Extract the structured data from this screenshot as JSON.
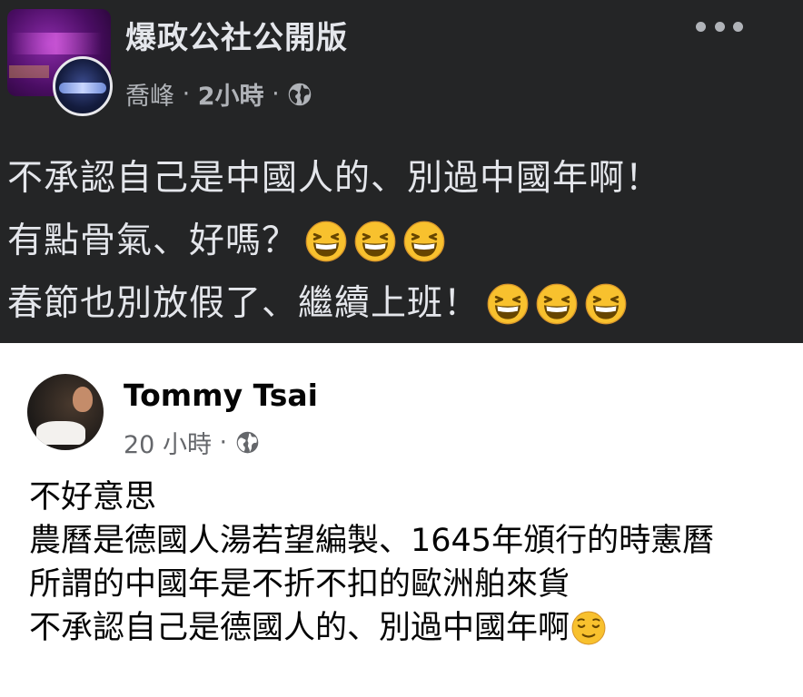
{
  "original_post": {
    "page_name": "爆政公社公開版",
    "author": "喬峰",
    "time": "2小時",
    "privacy_icon": "globe-icon",
    "menu_icon": "more-horizontal-icon",
    "lines": [
      {
        "text": "不承認自己是中國人的、別過中國年啊！",
        "emoji": []
      },
      {
        "text": "有點骨氣、好嗎？",
        "emoji": [
          "grinning-squinting-face",
          "grinning-squinting-face",
          "grinning-squinting-face"
        ]
      },
      {
        "text": "春節也別放假了、繼續上班！",
        "emoji": [
          "grinning-squinting-face",
          "grinning-squinting-face",
          "grinning-squinting-face"
        ]
      }
    ],
    "colors": {
      "background": "#242526",
      "primary_text": "#e4e6eb",
      "secondary_text": "#b0b3b8"
    }
  },
  "comment": {
    "author": "Tommy Tsai",
    "time": "20 小時",
    "privacy_icon": "globe-icon",
    "lines": [
      {
        "text": "不好意思",
        "emoji": []
      },
      {
        "text": "農曆是德國人湯若望編製、1645年頒行的時憲曆",
        "emoji": []
      },
      {
        "text": "所謂的中國年是不折不扣的歐洲舶來貨",
        "emoji": []
      },
      {
        "text": "不承認自己是德國人的、別過中國年啊",
        "emoji": [
          "relieved-face"
        ]
      }
    ],
    "colors": {
      "background": "#ffffff",
      "primary_text": "#050505",
      "secondary_text": "#65676b"
    }
  }
}
